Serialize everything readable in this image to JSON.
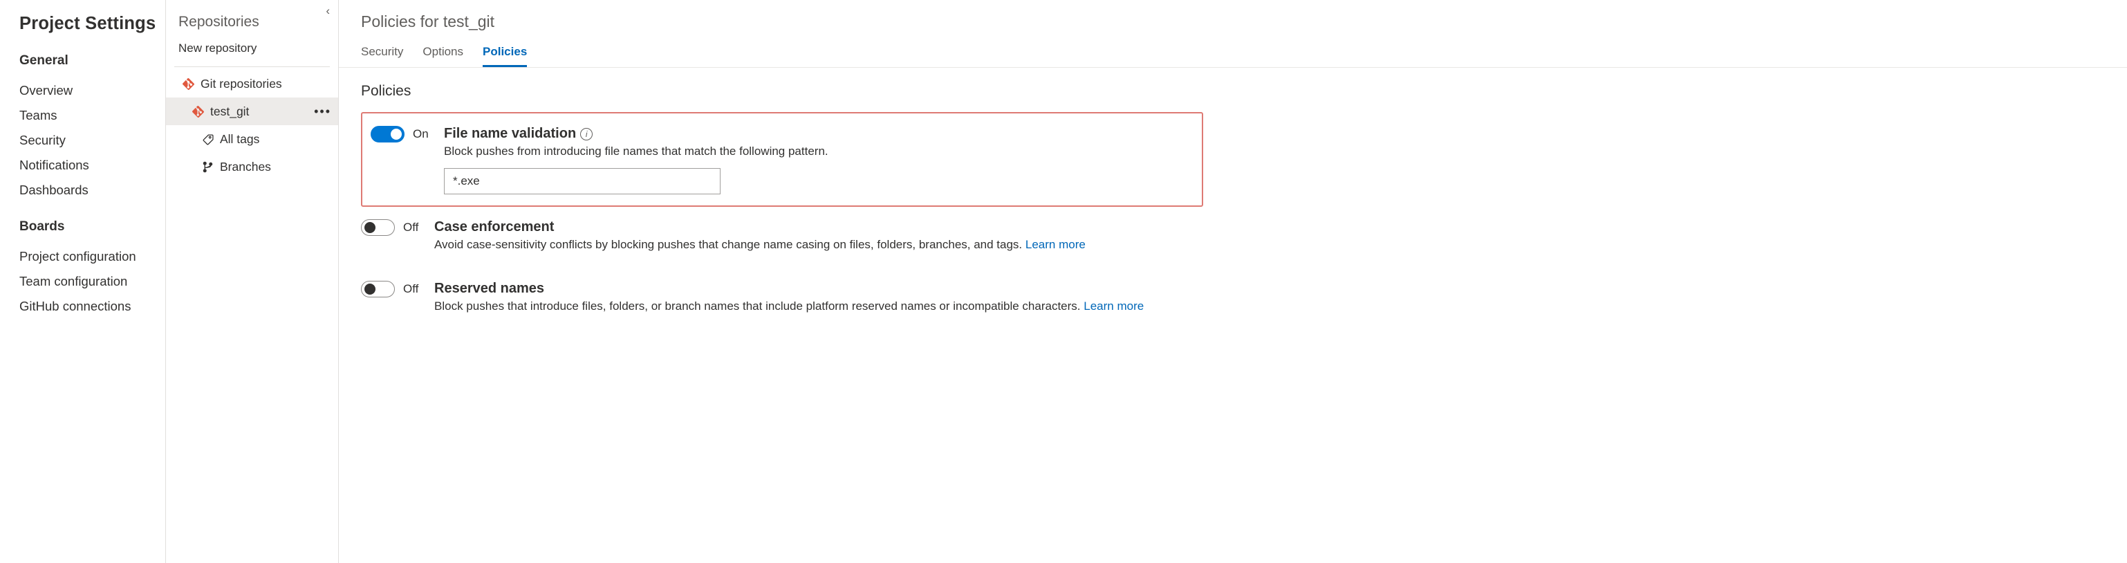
{
  "project_settings": {
    "title": "Project Settings",
    "sections": [
      {
        "header": "General",
        "items": [
          "Overview",
          "Teams",
          "Security",
          "Notifications",
          "Dashboards"
        ]
      },
      {
        "header": "Boards",
        "items": [
          "Project configuration",
          "Team configuration",
          "GitHub connections"
        ]
      }
    ]
  },
  "repositories_panel": {
    "title": "Repositories",
    "new_repo_label": "New repository",
    "tree": {
      "root_label": "Git repositories",
      "selected_repo": "test_git",
      "children": [
        "All tags",
        "Branches"
      ]
    }
  },
  "main": {
    "title": "Policies for test_git",
    "tabs": [
      "Security",
      "Options",
      "Policies"
    ],
    "active_tab": "Policies",
    "subsection_title": "Policies",
    "policies": [
      {
        "id": "file_name_validation",
        "on": true,
        "toggle_state": "On",
        "title": "File name validation",
        "desc": "Block pushes from introducing file names that match the following pattern.",
        "input_value": "*.exe",
        "highlighted": true,
        "has_input": true
      },
      {
        "id": "case_enforcement",
        "on": false,
        "toggle_state": "Off",
        "title": "Case enforcement",
        "desc": "Avoid case-sensitivity conflicts by blocking pushes that change name casing on files, folders, branches, and tags. ",
        "learn_more": "Learn more"
      },
      {
        "id": "reserved_names",
        "on": false,
        "toggle_state": "Off",
        "title": "Reserved names",
        "desc": "Block pushes that introduce files, folders, or branch names that include platform reserved names or incompatible characters. ",
        "learn_more": "Learn more"
      }
    ]
  }
}
